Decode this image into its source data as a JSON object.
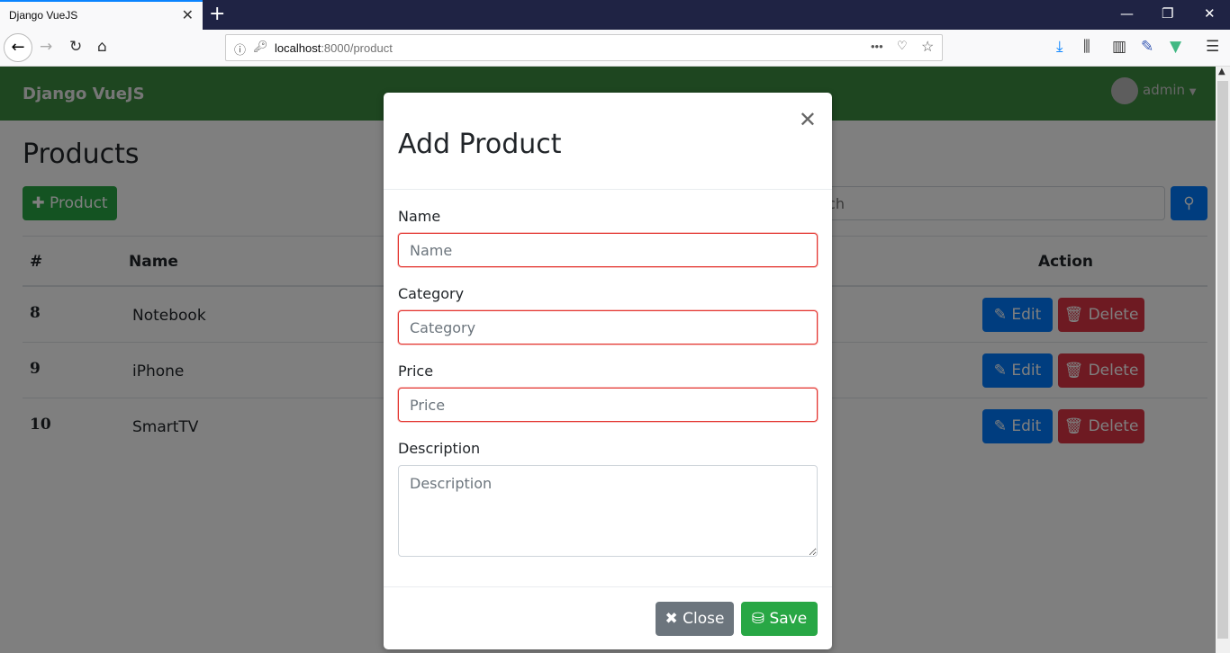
{
  "browser": {
    "tab_title": "Django VueJS",
    "url_host": "localhost",
    "url_path": ":8000/product"
  },
  "navbar": {
    "brand": "Django VueJS",
    "user": "admin"
  },
  "page": {
    "title": "Products",
    "add_button": "Product",
    "search_placeholder": "Search"
  },
  "table": {
    "headers": [
      "#",
      "Name",
      "Action"
    ],
    "rows": [
      {
        "id": "8",
        "name": "Notebook"
      },
      {
        "id": "9",
        "name": "iPhone"
      },
      {
        "id": "10",
        "name": "SmartTV"
      }
    ],
    "edit_label": "Edit",
    "delete_label": "Delete"
  },
  "modal": {
    "title": "Add Product",
    "fields": [
      {
        "label": "Name",
        "placeholder": "Name"
      },
      {
        "label": "Category",
        "placeholder": "Category"
      },
      {
        "label": "Price",
        "placeholder": "Price"
      },
      {
        "label": "Description",
        "placeholder": "Description"
      }
    ],
    "close_label": "Close",
    "save_label": "Save"
  },
  "colors": {
    "navbar": "#3c8c40",
    "primary": "#007bff",
    "danger": "#dc3545",
    "success": "#28a745",
    "secondary": "#6c757d",
    "invalid": "#e3342f"
  }
}
